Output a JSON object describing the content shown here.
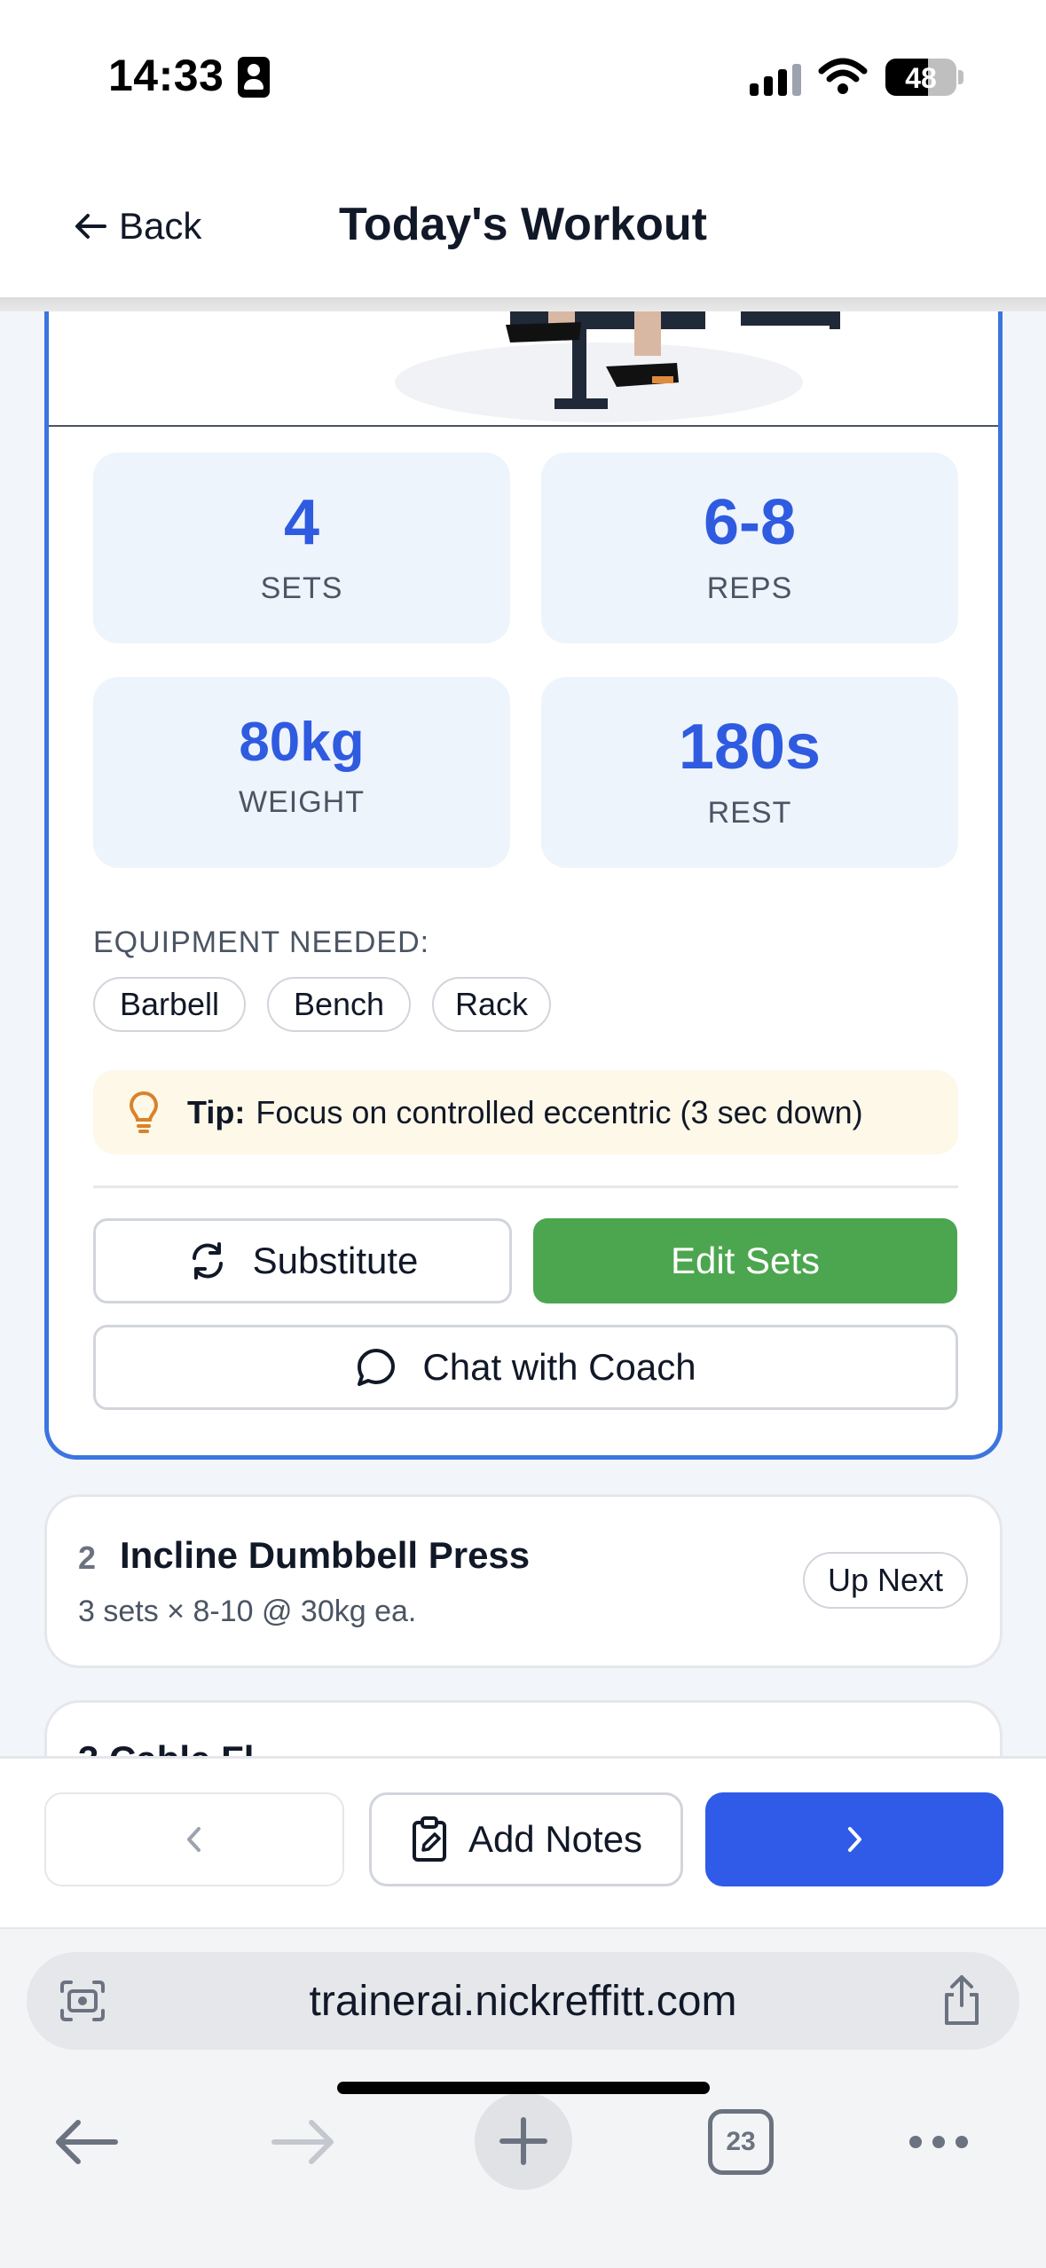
{
  "status_bar": {
    "time": "14:33",
    "battery": "48"
  },
  "header": {
    "back_label": "Back",
    "title": "Today's Workout"
  },
  "current_exercise": {
    "stats": {
      "sets": {
        "value": "4",
        "label": "SETS"
      },
      "reps": {
        "value": "6-8",
        "label": "REPS"
      },
      "weight": {
        "value": "80kg",
        "label": "WEIGHT"
      },
      "rest": {
        "value": "180s",
        "label": "REST"
      }
    },
    "equipment_label": "EQUIPMENT NEEDED:",
    "equipment": [
      "Barbell",
      "Bench",
      "Rack"
    ],
    "tip_label": "Tip:",
    "tip_text": "Focus on controlled eccentric (3 sec down)",
    "buttons": {
      "substitute": "Substitute",
      "edit_sets": "Edit Sets",
      "chat_coach": "Chat with Coach"
    }
  },
  "next_exercise": {
    "number": "2",
    "name": "Incline Dumbbell Press",
    "detail": "3 sets × 8-10 @ 30kg ea.",
    "badge": "Up Next"
  },
  "third_exercise": {
    "title_partial": "3  Cable Fl..."
  },
  "action_bar": {
    "add_notes": "Add Notes"
  },
  "browser": {
    "url": "trainerai.nickreffitt.com",
    "tab_count": "23"
  },
  "colors": {
    "accent_blue": "#2f5be8",
    "green": "#4ca64f",
    "stat_bg": "#eef4fc",
    "tip_bg": "#fdf8e8"
  }
}
